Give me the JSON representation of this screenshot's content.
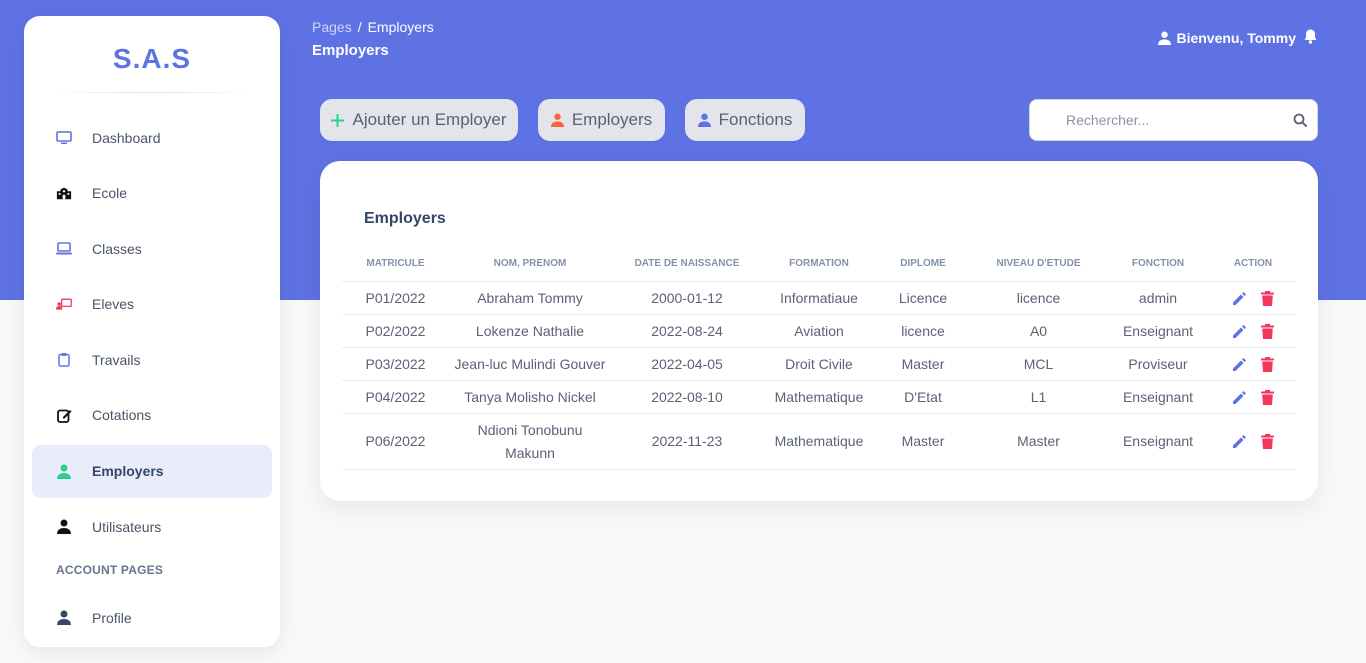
{
  "brand": "S.A.S",
  "sidebar": {
    "items": [
      {
        "label": "Dashboard",
        "icon": "monitor-icon",
        "active": false
      },
      {
        "label": "Ecole",
        "icon": "school-icon",
        "active": false
      },
      {
        "label": "Classes",
        "icon": "laptop-icon",
        "active": false
      },
      {
        "label": "Eleves",
        "icon": "chalkboard-teacher-icon",
        "active": false
      },
      {
        "label": "Travails",
        "icon": "clipboard-icon",
        "active": false
      },
      {
        "label": "Cotations",
        "icon": "edit-icon",
        "active": false
      },
      {
        "label": "Employers",
        "icon": "user-icon",
        "active": true
      },
      {
        "label": "Utilisateurs",
        "icon": "user-icon",
        "active": false
      }
    ],
    "section_title": "ACCOUNT PAGES",
    "account_items": [
      {
        "label": "Profile",
        "icon": "user-icon"
      }
    ]
  },
  "header": {
    "breadcrumb_root": "Pages",
    "breadcrumb_sep": "/",
    "breadcrumb_current": "Employers",
    "title": "Employers",
    "welcome": "Bienvenu, Tommy"
  },
  "actions": {
    "add_label": "Ajouter un Employer",
    "employers_label": "Employers",
    "fonctions_label": "Fonctions"
  },
  "search": {
    "placeholder": "Rechercher..."
  },
  "table": {
    "title": "Employers",
    "columns": [
      "MATRICULE",
      "NOM, PRENOM",
      "DATE DE NAISSANCE",
      "FORMATION",
      "DIPLOME",
      "NIVEAU D'ETUDE",
      "FONCTION",
      "ACTION"
    ],
    "rows": [
      [
        "P01/2022",
        "Abraham Tommy",
        "2000-01-12",
        "Informatiaue",
        "Licence",
        "licence",
        "admin"
      ],
      [
        "P02/2022",
        "Lokenze Nathalie",
        "2022-08-24",
        "Aviation",
        "licence",
        "A0",
        "Enseignant"
      ],
      [
        "P03/2022",
        "Jean-luc Mulindi Gouver",
        "2022-04-05",
        "Droit Civile",
        "Master",
        "MCL",
        "Proviseur"
      ],
      [
        "P04/2022",
        "Tanya Molisho Nickel",
        "2022-08-10",
        "Mathematique",
        "D'Etat",
        "L1",
        "Enseignant"
      ],
      [
        "P06/2022",
        "Ndioni Tonobunu Makunn",
        "2022-11-23",
        "Mathematique",
        "Master",
        "Master",
        "Enseignant"
      ]
    ]
  },
  "colors": {
    "primary": "#5e72e4",
    "danger": "#f5365c",
    "success": "#2dce89",
    "orange": "#fb6340"
  }
}
